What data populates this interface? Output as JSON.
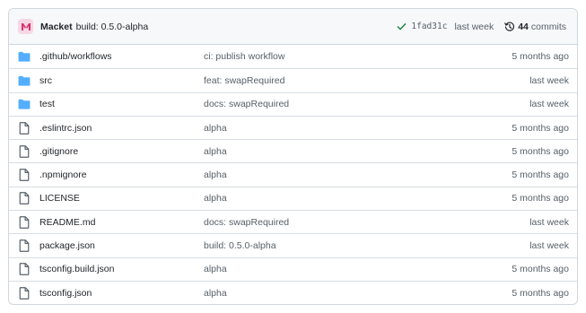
{
  "colors": {
    "folder": "#54aeff",
    "file_outline": "#57606a",
    "check": "#1a7f37",
    "avatar_bg": "#f7d7e4",
    "avatar_fg": "#d6336c"
  },
  "header": {
    "avatar_icon": "avatar-logo",
    "author": "Macket",
    "message": "build: 0.5.0-alpha",
    "status_icon": "check-icon",
    "sha": "1fad31c",
    "time": "last week",
    "commits_count": "44",
    "commits_label": "commits"
  },
  "files": [
    {
      "type": "dir",
      "icon": "folder-icon",
      "name": ".github/workflows",
      "commit": "ci: publish workflow",
      "age": "5 months ago"
    },
    {
      "type": "dir",
      "icon": "folder-icon",
      "name": "src",
      "commit": "feat: swapRequired",
      "age": "last week"
    },
    {
      "type": "dir",
      "icon": "folder-icon",
      "name": "test",
      "commit": "docs: swapRequired",
      "age": "last week"
    },
    {
      "type": "file",
      "icon": "file-icon",
      "name": ".eslintrc.json",
      "commit": "alpha",
      "age": "5 months ago"
    },
    {
      "type": "file",
      "icon": "file-icon",
      "name": ".gitignore",
      "commit": "alpha",
      "age": "5 months ago"
    },
    {
      "type": "file",
      "icon": "file-icon",
      "name": ".npmignore",
      "commit": "alpha",
      "age": "5 months ago"
    },
    {
      "type": "file",
      "icon": "file-icon",
      "name": "LICENSE",
      "commit": "alpha",
      "age": "5 months ago"
    },
    {
      "type": "file",
      "icon": "file-icon",
      "name": "README.md",
      "commit": "docs: swapRequired",
      "age": "last week"
    },
    {
      "type": "file",
      "icon": "file-icon",
      "name": "package.json",
      "commit": "build: 0.5.0-alpha",
      "age": "last week"
    },
    {
      "type": "file",
      "icon": "file-icon",
      "name": "tsconfig.build.json",
      "commit": "alpha",
      "age": "5 months ago"
    },
    {
      "type": "file",
      "icon": "file-icon",
      "name": "tsconfig.json",
      "commit": "alpha",
      "age": "5 months ago"
    }
  ]
}
